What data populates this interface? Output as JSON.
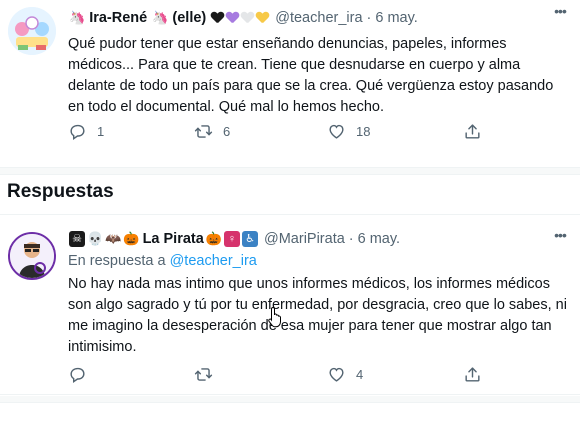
{
  "tweet": {
    "name": "Ira-René",
    "name_suffix": "(elle)",
    "handle": "@teacher_ira",
    "dot": "·",
    "time": "6 may.",
    "text": "Qué pudor tener que estar enseñando denuncias, papeles, informes médicos... Para que te crean. Tiene que desnudarse en cuerpo y alma delante de todo un país para que se la crea. Qué vergüenza estoy pasando en todo el documental. Qué mal lo hemos hecho.",
    "stats": {
      "replies": "1",
      "retweets": "6",
      "likes": "18"
    },
    "heart_colors": [
      "#1a1a1a",
      "#a77be0",
      "#f0f0f0",
      "#f7c948"
    ]
  },
  "section": {
    "title": "Respuestas"
  },
  "reply": {
    "name": "La Pirata",
    "handle": "@MariPirata",
    "dot": "·",
    "time": "6 may.",
    "reply_prefix": "En respuesta a",
    "reply_to": "@teacher_ira",
    "text": "No hay nada mas intimo que unos informes médicos, los informes médicos son algo sagrado y tú por tu enfermedad, por desgracia, creo que lo sabes, ni me imagino la desesperación de esa mujer para tener que mostrar algo tan intimisimo.",
    "stats": {
      "replies": "",
      "retweets": "",
      "likes": "4"
    }
  },
  "icons": {
    "more": "more-icon",
    "reply": "reply-icon",
    "retweet": "retweet-icon",
    "like": "heart-icon",
    "share": "share-icon"
  },
  "colors": {
    "link": "#1d9bf0",
    "muted": "#536471",
    "text": "#0f1419",
    "reply_avatar_border": "#6d2ea7"
  }
}
